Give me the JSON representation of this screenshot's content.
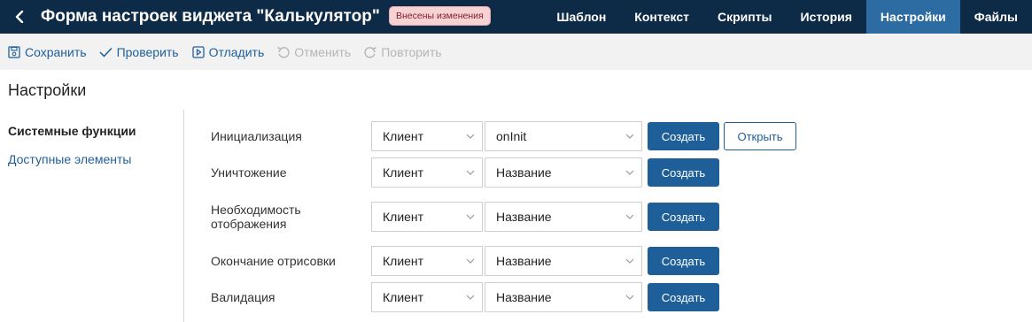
{
  "header": {
    "title": "Форма настроек виджета \"Калькулятор\"",
    "badge": "Внесены изменения",
    "tabs": [
      "Шаблон",
      "Контекст",
      "Скрипты",
      "История",
      "Настройки",
      "Файлы"
    ],
    "active_tab": "Настройки",
    "colors": {
      "background": "#0d2a47",
      "active_tab": "#2d6ca3",
      "badge_bg": "#f7d2d4"
    }
  },
  "toolbar": {
    "save": {
      "label": "Сохранить",
      "icon": "save-icon"
    },
    "check": {
      "label": "Проверить",
      "icon": "checkmark-icon"
    },
    "debug": {
      "label": "Отладить",
      "icon": "debug-icon"
    },
    "undo": {
      "label": "Отменить",
      "icon": "undo-icon",
      "disabled": true
    },
    "redo": {
      "label": "Повторить",
      "icon": "redo-icon",
      "disabled": true
    }
  },
  "page": {
    "title": "Настройки"
  },
  "sidebar": {
    "items": [
      {
        "label": "Системные функции",
        "active": true
      },
      {
        "label": "Доступные элементы",
        "active": false
      }
    ]
  },
  "settings": {
    "rows": [
      {
        "label": "Инициализация",
        "client": "Клиент",
        "function": "onInit",
        "create_label": "Создать",
        "open_label": "Открыть"
      },
      {
        "label": "Уничтожение",
        "client": "Клиент",
        "function": "Название",
        "create_label": "Создать"
      },
      {
        "label": "Необходимость отображения",
        "client": "Клиент",
        "function": "Название",
        "create_label": "Создать"
      },
      {
        "label": "Окончание отрисовки",
        "client": "Клиент",
        "function": "Название",
        "create_label": "Создать"
      },
      {
        "label": "Валидация",
        "client": "Клиент",
        "function": "Название",
        "create_label": "Создать"
      }
    ]
  },
  "accent_color": "#1f5f99"
}
